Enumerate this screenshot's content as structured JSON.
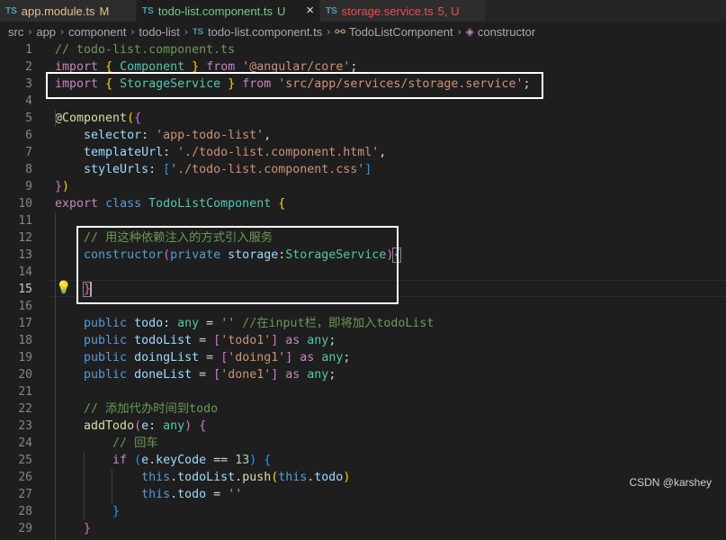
{
  "tabs": [
    {
      "lang": "TS",
      "name": "app.module.ts",
      "status": "M",
      "name_color": "#e2c08d",
      "status_color": "#e2c08d",
      "active": false
    },
    {
      "lang": "TS",
      "name": "todo-list.component.ts",
      "status": "U",
      "name_color": "#73c991",
      "status_color": "#73c991",
      "active": true
    },
    {
      "lang": "TS",
      "name": "storage.service.ts",
      "status": "5, U",
      "name_color": "#f14c4c",
      "status_color": "#f14c4c",
      "active": false
    }
  ],
  "close_icon": "close-icon",
  "breadcrumb": [
    "src",
    "app",
    "component",
    "todo-list",
    "todo-list.component.ts",
    "TodoListComponent",
    "constructor"
  ],
  "breadcrumb_icons": {
    "file": "TS",
    "class": "component-icon",
    "method": "cube-icon"
  },
  "active_line": 15,
  "lines": [
    {
      "n": 1,
      "t": [
        [
          "c-com",
          "// todo-list.component.ts"
        ]
      ]
    },
    {
      "n": 2,
      "t": [
        [
          "c-ctl",
          "import"
        ],
        [
          "",
          " "
        ],
        [
          "c-p1",
          "{"
        ],
        [
          "",
          " "
        ],
        [
          "c-type",
          "Component"
        ],
        [
          "",
          " "
        ],
        [
          "c-p1",
          "}"
        ],
        [
          "",
          " "
        ],
        [
          "c-ctl",
          "from"
        ],
        [
          "",
          " "
        ],
        [
          "c-str",
          "'@angular/core'"
        ],
        [
          "",
          ";"
        ]
      ]
    },
    {
      "n": 3,
      "t": [
        [
          "c-ctl",
          "import"
        ],
        [
          "",
          " "
        ],
        [
          "c-p1",
          "{"
        ],
        [
          "",
          " "
        ],
        [
          "c-type",
          "StorageService"
        ],
        [
          "",
          " "
        ],
        [
          "c-p1",
          "}"
        ],
        [
          "",
          " "
        ],
        [
          "c-ctl",
          "from"
        ],
        [
          "",
          " "
        ],
        [
          "c-str",
          "'src/app/services/storage.service'"
        ],
        [
          "",
          ";"
        ]
      ]
    },
    {
      "n": 4,
      "t": []
    },
    {
      "n": 5,
      "t": [
        [
          "c-fn",
          "@Component"
        ],
        [
          "c-p1",
          "("
        ],
        [
          "c-p2",
          "{"
        ]
      ]
    },
    {
      "n": 6,
      "t": [
        [
          "",
          "    "
        ],
        [
          "c-var",
          "selector"
        ],
        [
          "",
          ": "
        ],
        [
          "c-str",
          "'app-todo-list'"
        ],
        [
          "",
          ","
        ]
      ]
    },
    {
      "n": 7,
      "t": [
        [
          "",
          "    "
        ],
        [
          "c-var",
          "templateUrl"
        ],
        [
          "",
          ": "
        ],
        [
          "c-str",
          "'./todo-list.component.html'"
        ],
        [
          "",
          ","
        ]
      ]
    },
    {
      "n": 8,
      "t": [
        [
          "",
          "    "
        ],
        [
          "c-var",
          "styleUrls"
        ],
        [
          "",
          ": "
        ],
        [
          "c-p3",
          "["
        ],
        [
          "c-str",
          "'./todo-list.component.css'"
        ],
        [
          "c-p3",
          "]"
        ]
      ]
    },
    {
      "n": 9,
      "t": [
        [
          "c-p2",
          "}"
        ],
        [
          "c-p1",
          ")"
        ]
      ]
    },
    {
      "n": 10,
      "t": [
        [
          "c-ctl",
          "export"
        ],
        [
          "",
          " "
        ],
        [
          "c-kw",
          "class"
        ],
        [
          "",
          " "
        ],
        [
          "c-type",
          "TodoListComponent"
        ],
        [
          "",
          " "
        ],
        [
          "c-p1",
          "{"
        ]
      ]
    },
    {
      "n": 11,
      "t": []
    },
    {
      "n": 12,
      "t": [
        [
          "",
          "    "
        ],
        [
          "c-com",
          "// 用这种依赖注入的方式引入服务"
        ]
      ]
    },
    {
      "n": 13,
      "t": [
        [
          "",
          "    "
        ],
        [
          "c-kw",
          "constructor"
        ],
        [
          "c-p2",
          "("
        ],
        [
          "c-kw",
          "private"
        ],
        [
          "",
          " "
        ],
        [
          "c-var",
          "storage"
        ],
        [
          "",
          ":"
        ],
        [
          "c-type",
          "StorageService"
        ],
        [
          "c-p2",
          ")"
        ],
        [
          "c-p2 bracket-match",
          "{"
        ]
      ]
    },
    {
      "n": 14,
      "t": []
    },
    {
      "n": 15,
      "t": [
        [
          "",
          "    "
        ],
        [
          "c-p2 bracket-match",
          "}"
        ]
      ]
    },
    {
      "n": 16,
      "t": []
    },
    {
      "n": 17,
      "t": [
        [
          "",
          "    "
        ],
        [
          "c-kw",
          "public"
        ],
        [
          "",
          " "
        ],
        [
          "c-var",
          "todo"
        ],
        [
          "",
          ": "
        ],
        [
          "c-type",
          "any"
        ],
        [
          "",
          " = "
        ],
        [
          "c-str",
          "''"
        ],
        [
          "",
          " "
        ],
        [
          "c-com",
          "//在input栏，即将加入todoList"
        ]
      ]
    },
    {
      "n": 18,
      "t": [
        [
          "",
          "    "
        ],
        [
          "c-kw",
          "public"
        ],
        [
          "",
          " "
        ],
        [
          "c-var",
          "todoList"
        ],
        [
          "",
          " = "
        ],
        [
          "c-p2",
          "["
        ],
        [
          "c-str",
          "'todo1'"
        ],
        [
          "c-p2",
          "]"
        ],
        [
          "",
          " "
        ],
        [
          "c-ctl",
          "as"
        ],
        [
          "",
          " "
        ],
        [
          "c-type",
          "any"
        ],
        [
          "",
          ";"
        ]
      ]
    },
    {
      "n": 19,
      "t": [
        [
          "",
          "    "
        ],
        [
          "c-kw",
          "public"
        ],
        [
          "",
          " "
        ],
        [
          "c-var",
          "doingList"
        ],
        [
          "",
          " = "
        ],
        [
          "c-p2",
          "["
        ],
        [
          "c-str",
          "'doing1'"
        ],
        [
          "c-p2",
          "]"
        ],
        [
          "",
          " "
        ],
        [
          "c-ctl",
          "as"
        ],
        [
          "",
          " "
        ],
        [
          "c-type",
          "any"
        ],
        [
          "",
          ";"
        ]
      ]
    },
    {
      "n": 20,
      "t": [
        [
          "",
          "    "
        ],
        [
          "c-kw",
          "public"
        ],
        [
          "",
          " "
        ],
        [
          "c-var",
          "doneList"
        ],
        [
          "",
          " = "
        ],
        [
          "c-p2",
          "["
        ],
        [
          "c-str",
          "'done1'"
        ],
        [
          "c-p2",
          "]"
        ],
        [
          "",
          " "
        ],
        [
          "c-ctl",
          "as"
        ],
        [
          "",
          " "
        ],
        [
          "c-type",
          "any"
        ],
        [
          "",
          ";"
        ]
      ]
    },
    {
      "n": 21,
      "t": []
    },
    {
      "n": 22,
      "t": [
        [
          "",
          "    "
        ],
        [
          "c-com",
          "// 添加代办时间到todo"
        ]
      ]
    },
    {
      "n": 23,
      "t": [
        [
          "",
          "    "
        ],
        [
          "c-fn",
          "addTodo"
        ],
        [
          "c-p2",
          "("
        ],
        [
          "c-var",
          "e"
        ],
        [
          "",
          ": "
        ],
        [
          "c-type",
          "any"
        ],
        [
          "c-p2",
          ")"
        ],
        [
          "",
          " "
        ],
        [
          "c-p2",
          "{"
        ]
      ]
    },
    {
      "n": 24,
      "t": [
        [
          "",
          "        "
        ],
        [
          "c-com",
          "// 回车"
        ]
      ]
    },
    {
      "n": 25,
      "t": [
        [
          "",
          "        "
        ],
        [
          "c-ctl",
          "if"
        ],
        [
          "",
          " "
        ],
        [
          "c-p3",
          "("
        ],
        [
          "c-var",
          "e"
        ],
        [
          "",
          "."
        ],
        [
          "c-var",
          "keyCode"
        ],
        [
          "",
          " == "
        ],
        [
          "c-num",
          "13"
        ],
        [
          "c-p3",
          ")"
        ],
        [
          "",
          " "
        ],
        [
          "c-p3",
          "{"
        ]
      ]
    },
    {
      "n": 26,
      "t": [
        [
          "",
          "            "
        ],
        [
          "c-kw",
          "this"
        ],
        [
          "",
          "."
        ],
        [
          "c-var",
          "todoList"
        ],
        [
          "",
          "."
        ],
        [
          "c-fn",
          "push"
        ],
        [
          "c-p1",
          "("
        ],
        [
          "c-kw",
          "this"
        ],
        [
          "",
          "."
        ],
        [
          "c-var",
          "todo"
        ],
        [
          "c-p1",
          ")"
        ]
      ]
    },
    {
      "n": 27,
      "t": [
        [
          "",
          "            "
        ],
        [
          "c-kw",
          "this"
        ],
        [
          "",
          "."
        ],
        [
          "c-var",
          "todo"
        ],
        [
          "",
          " = "
        ],
        [
          "c-str",
          "''"
        ]
      ]
    },
    {
      "n": 28,
      "t": [
        [
          "",
          "        "
        ],
        [
          "c-p3",
          "}"
        ]
      ]
    },
    {
      "n": 29,
      "t": [
        [
          "",
          "    "
        ],
        [
          "c-p2",
          "}"
        ]
      ]
    }
  ],
  "lightbulb_icon": "lightbulb-icon",
  "watermark": "CSDN @karshey",
  "colors": {
    "background": "#1e1e1e",
    "tabbar": "#252526",
    "highlight_box": "#ffffff",
    "line_number": "#858585"
  }
}
